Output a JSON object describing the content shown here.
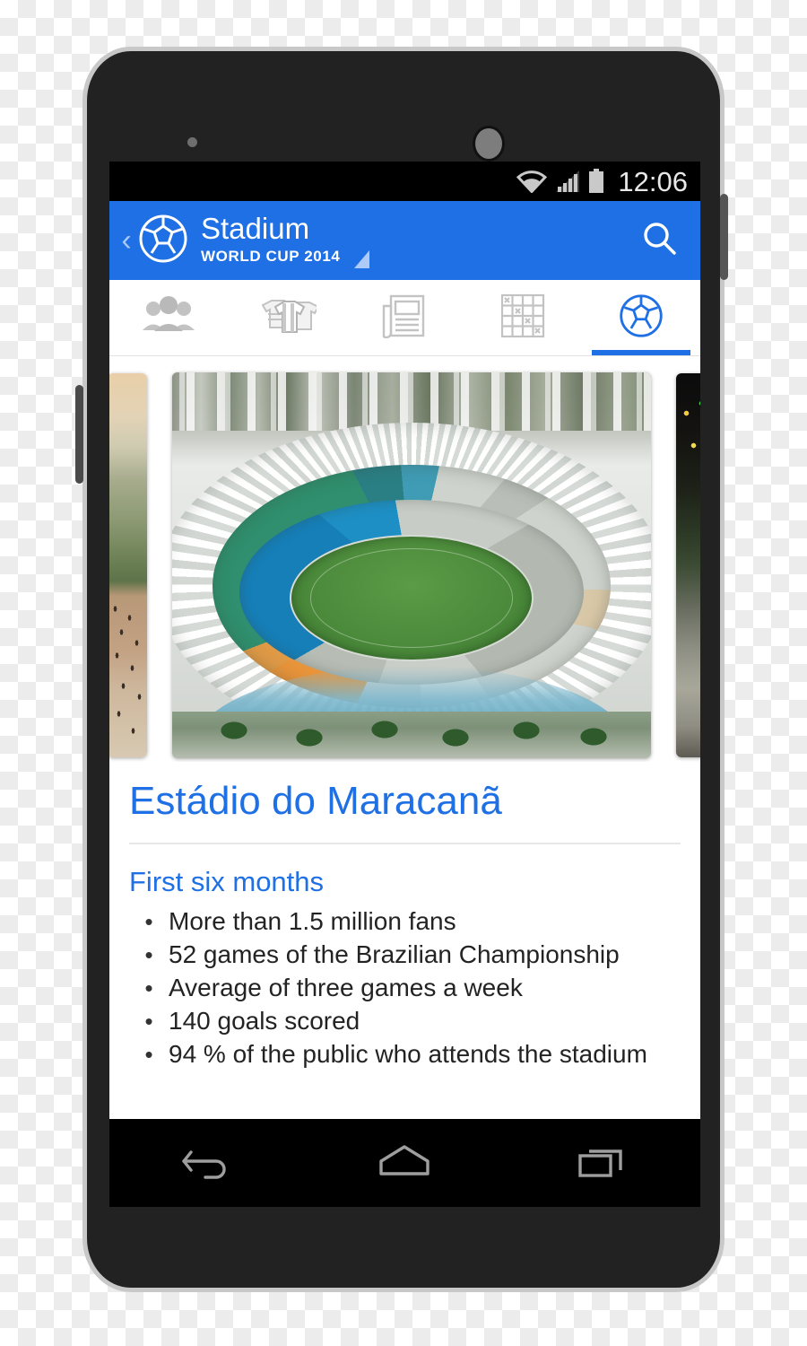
{
  "status_bar": {
    "time": "12:06",
    "icons": [
      "wifi-icon",
      "signal-icon",
      "battery-icon"
    ]
  },
  "app_bar": {
    "back_label": "‹",
    "logo_icon": "soccer-ball-icon",
    "title": "Stadium",
    "subtitle": "WORLD CUP 2014",
    "dropdown_icon": "triangle-dropdown-icon",
    "search_icon": "search-icon",
    "background_color": "#1f6fe5"
  },
  "tabs": [
    {
      "name": "tab-teams",
      "icon": "people-group-icon",
      "active": false
    },
    {
      "name": "tab-jerseys",
      "icon": "jerseys-icon",
      "active": false
    },
    {
      "name": "tab-news",
      "icon": "newspaper-icon",
      "active": false
    },
    {
      "name": "tab-brackets",
      "icon": "grid-table-icon",
      "active": false
    },
    {
      "name": "tab-stadiums",
      "icon": "soccer-ball-icon",
      "active": true
    }
  ],
  "carousel": {
    "previous_photo_alt": "Aerial view of stadium plaza with crowds",
    "current_photo_alt": "Aerial view of Estadio do Maracana stadium",
    "next_photo_alt": "Night view of stadium surroundings"
  },
  "content": {
    "stadium_name": "Estádio do Maracanã",
    "section_title": "First six months",
    "bullet_char": "•",
    "facts": [
      "More than 1.5 million fans",
      "52 games of the Brazilian Championship",
      "Average of three games a week",
      "140 goals scored",
      "94 % of the public who attends the stadium"
    ]
  },
  "nav_bar": {
    "back_icon": "android-back-icon",
    "home_icon": "android-home-icon",
    "recents_icon": "android-recents-icon"
  },
  "theme": {
    "accent": "#1f6fe5",
    "text": "#232323",
    "tab_inactive": "#c3c3c3"
  }
}
